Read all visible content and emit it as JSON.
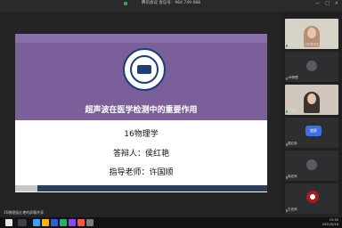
{
  "top": {
    "meeting_title": "腾讯会议 会议号：964 749 088"
  },
  "window_controls": {
    "minimize": "—",
    "maximize": "□",
    "close": "×"
  },
  "slide": {
    "title": "超声波在医学检测中的重要作用",
    "line1": "16物理学",
    "line2": "答辩人：侯红艳",
    "line3": "指导老师：许国顺"
  },
  "progress": {
    "fraction": 0.09
  },
  "participants": [
    {
      "name": "正在发言：18物理侯红艳"
    },
    {
      "name": "18物理"
    },
    {
      "name": "许国顺"
    },
    {
      "name": "侯红艳"
    },
    {
      "name": "徐老师"
    },
    {
      "name": "王老师"
    }
  ],
  "center_button": {
    "label": "锁屏"
  },
  "status": {
    "text": "16物理侯红艳的屏幕共享"
  },
  "tray": {
    "time": "15:30",
    "date": "2020/5/16"
  },
  "colors": {
    "slide_purple": "#7a5f9b",
    "accent_blue": "#3f6fe6",
    "taskbar_bg": "#121215"
  }
}
